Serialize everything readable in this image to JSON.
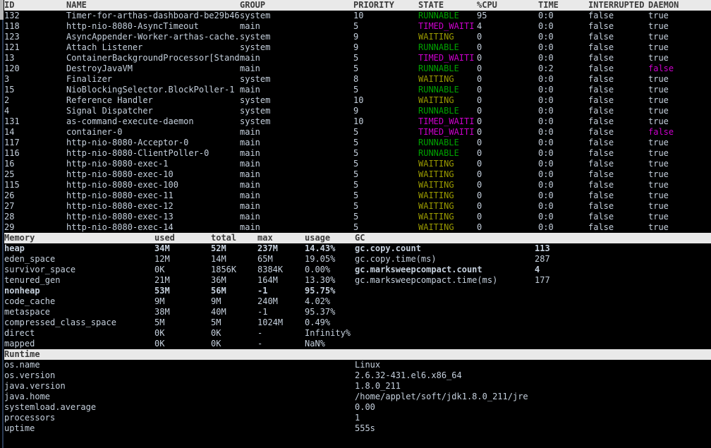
{
  "app": {
    "name": "arthas-dashboard",
    "terminal_bg": "#000000",
    "fg": "#c5d0dd",
    "header_bg": "#e9e9e9",
    "header_fg": "#3a3a3a",
    "state_colors": {
      "RUNNABLE": "#00a000",
      "TIMED_WAITI": "#cc00cc",
      "WAITING": "#9a9a00"
    }
  },
  "threads": {
    "columns": [
      "ID",
      "NAME",
      "GROUP",
      "PRIORITY",
      "STATE",
      "%CPU",
      "TIME",
      "INTERRUPTED",
      "DAEMON"
    ],
    "rows": [
      {
        "id": "132",
        "name": "Timer-for-arthas-dashboard-be29b46",
        "group": "system",
        "priority": "10",
        "state": "RUNNABLE",
        "state_color": "green",
        "cpu": "95",
        "time": "0:0",
        "interrupted": "false",
        "daemon": "true",
        "daemon_color": "default"
      },
      {
        "id": "118",
        "name": "http-nio-8080-AsyncTimeout",
        "group": "main",
        "priority": "5",
        "state": "TIMED_WAITI",
        "state_color": "magenta",
        "cpu": "4",
        "time": "0:0",
        "interrupted": "false",
        "daemon": "true",
        "daemon_color": "default"
      },
      {
        "id": "123",
        "name": "AsyncAppender-Worker-arthas-cache.",
        "group": "system",
        "priority": "9",
        "state": "WAITING",
        "state_color": "yellow",
        "cpu": "0",
        "time": "0:0",
        "interrupted": "false",
        "daemon": "true",
        "daemon_color": "default"
      },
      {
        "id": "121",
        "name": "Attach Listener",
        "group": "system",
        "priority": "9",
        "state": "RUNNABLE",
        "state_color": "green",
        "cpu": "0",
        "time": "0:0",
        "interrupted": "false",
        "daemon": "true",
        "daemon_color": "default"
      },
      {
        "id": "13",
        "name": "ContainerBackgroundProcessor[Stand",
        "group": "main",
        "priority": "5",
        "state": "TIMED_WAITI",
        "state_color": "magenta",
        "cpu": "0",
        "time": "0:0",
        "interrupted": "false",
        "daemon": "true",
        "daemon_color": "default"
      },
      {
        "id": "120",
        "name": "DestroyJavaVM",
        "group": "main",
        "priority": "5",
        "state": "RUNNABLE",
        "state_color": "green",
        "cpu": "0",
        "time": "0:2",
        "interrupted": "false",
        "daemon": "false",
        "daemon_color": "magenta"
      },
      {
        "id": "3",
        "name": "Finalizer",
        "group": "system",
        "priority": "8",
        "state": "WAITING",
        "state_color": "yellow",
        "cpu": "0",
        "time": "0:0",
        "interrupted": "false",
        "daemon": "true",
        "daemon_color": "default"
      },
      {
        "id": "15",
        "name": "NioBlockingSelector.BlockPoller-1",
        "group": "main",
        "priority": "5",
        "state": "RUNNABLE",
        "state_color": "green",
        "cpu": "0",
        "time": "0:0",
        "interrupted": "false",
        "daemon": "true",
        "daemon_color": "default"
      },
      {
        "id": "2",
        "name": "Reference Handler",
        "group": "system",
        "priority": "10",
        "state": "WAITING",
        "state_color": "yellow",
        "cpu": "0",
        "time": "0:0",
        "interrupted": "false",
        "daemon": "true",
        "daemon_color": "default"
      },
      {
        "id": "4",
        "name": "Signal Dispatcher",
        "group": "system",
        "priority": "9",
        "state": "RUNNABLE",
        "state_color": "green",
        "cpu": "0",
        "time": "0:0",
        "interrupted": "false",
        "daemon": "true",
        "daemon_color": "default"
      },
      {
        "id": "131",
        "name": "as-command-execute-daemon",
        "group": "system",
        "priority": "10",
        "state": "TIMED_WAITI",
        "state_color": "magenta",
        "cpu": "0",
        "time": "0:0",
        "interrupted": "false",
        "daemon": "true",
        "daemon_color": "default"
      },
      {
        "id": "14",
        "name": "container-0",
        "group": "main",
        "priority": "5",
        "state": "TIMED_WAITI",
        "state_color": "magenta",
        "cpu": "0",
        "time": "0:0",
        "interrupted": "false",
        "daemon": "false",
        "daemon_color": "magenta"
      },
      {
        "id": "117",
        "name": "http-nio-8080-Acceptor-0",
        "group": "main",
        "priority": "5",
        "state": "RUNNABLE",
        "state_color": "green",
        "cpu": "0",
        "time": "0:0",
        "interrupted": "false",
        "daemon": "true",
        "daemon_color": "default"
      },
      {
        "id": "116",
        "name": "http-nio-8080-ClientPoller-0",
        "group": "main",
        "priority": "5",
        "state": "RUNNABLE",
        "state_color": "green",
        "cpu": "0",
        "time": "0:0",
        "interrupted": "false",
        "daemon": "true",
        "daemon_color": "default"
      },
      {
        "id": "16",
        "name": "http-nio-8080-exec-1",
        "group": "main",
        "priority": "5",
        "state": "WAITING",
        "state_color": "yellow",
        "cpu": "0",
        "time": "0:0",
        "interrupted": "false",
        "daemon": "true",
        "daemon_color": "default"
      },
      {
        "id": "25",
        "name": "http-nio-8080-exec-10",
        "group": "main",
        "priority": "5",
        "state": "WAITING",
        "state_color": "yellow",
        "cpu": "0",
        "time": "0:0",
        "interrupted": "false",
        "daemon": "true",
        "daemon_color": "default"
      },
      {
        "id": "115",
        "name": "http-nio-8080-exec-100",
        "group": "main",
        "priority": "5",
        "state": "WAITING",
        "state_color": "yellow",
        "cpu": "0",
        "time": "0:0",
        "interrupted": "false",
        "daemon": "true",
        "daemon_color": "default"
      },
      {
        "id": "26",
        "name": "http-nio-8080-exec-11",
        "group": "main",
        "priority": "5",
        "state": "WAITING",
        "state_color": "yellow",
        "cpu": "0",
        "time": "0:0",
        "interrupted": "false",
        "daemon": "true",
        "daemon_color": "default"
      },
      {
        "id": "27",
        "name": "http-nio-8080-exec-12",
        "group": "main",
        "priority": "5",
        "state": "WAITING",
        "state_color": "yellow",
        "cpu": "0",
        "time": "0:0",
        "interrupted": "false",
        "daemon": "true",
        "daemon_color": "default"
      },
      {
        "id": "28",
        "name": "http-nio-8080-exec-13",
        "group": "main",
        "priority": "5",
        "state": "WAITING",
        "state_color": "yellow",
        "cpu": "0",
        "time": "0:0",
        "interrupted": "false",
        "daemon": "true",
        "daemon_color": "default"
      },
      {
        "id": "29",
        "name": "http-nio-8080-exec-14",
        "group": "main",
        "priority": "5",
        "state": "WAITING",
        "state_color": "yellow",
        "cpu": "0",
        "time": "0:0",
        "interrupted": "false",
        "daemon": "true",
        "daemon_color": "default"
      }
    ]
  },
  "memory": {
    "columns": [
      "Memory",
      "used",
      "total",
      "max",
      "usage"
    ],
    "rows": [
      {
        "name": "heap",
        "used": "34M",
        "total": "52M",
        "max": "237M",
        "usage": "14.43%",
        "bold": true
      },
      {
        "name": "eden_space",
        "used": "12M",
        "total": "14M",
        "max": "65M",
        "usage": "19.05%",
        "bold": false
      },
      {
        "name": "survivor_space",
        "used": "0K",
        "total": "1856K",
        "max": "8384K",
        "usage": "0.00%",
        "bold": false
      },
      {
        "name": "tenured_gen",
        "used": "21M",
        "total": "36M",
        "max": "164M",
        "usage": "13.30%",
        "bold": false
      },
      {
        "name": "nonheap",
        "used": "53M",
        "total": "56M",
        "max": "-1",
        "usage": "95.75%",
        "bold": true
      },
      {
        "name": "code_cache",
        "used": "9M",
        "total": "9M",
        "max": "240M",
        "usage": "4.02%",
        "bold": false
      },
      {
        "name": "metaspace",
        "used": "38M",
        "total": "40M",
        "max": "-1",
        "usage": "95.37%",
        "bold": false
      },
      {
        "name": "compressed_class_space",
        "used": "5M",
        "total": "5M",
        "max": "1024M",
        "usage": "0.49%",
        "bold": false
      },
      {
        "name": "direct",
        "used": "0K",
        "total": "0K",
        "max": "-",
        "usage": "Infinity%",
        "bold": false
      },
      {
        "name": "mapped",
        "used": "0K",
        "total": "0K",
        "max": "-",
        "usage": "NaN%",
        "bold": false
      }
    ]
  },
  "gc": {
    "header": "GC",
    "rows": [
      {
        "name": "gc.copy.count",
        "value": "113",
        "bold": true
      },
      {
        "name": "gc.copy.time(ms)",
        "value": "287",
        "bold": false
      },
      {
        "name": "gc.marksweepcompact.count",
        "value": "4",
        "bold": true
      },
      {
        "name": "gc.marksweepcompact.time(ms)",
        "value": "177",
        "bold": false
      }
    ]
  },
  "runtime": {
    "header": "Runtime",
    "rows": [
      {
        "name": "os.name",
        "value": "Linux"
      },
      {
        "name": "os.version",
        "value": "2.6.32-431.el6.x86_64"
      },
      {
        "name": "java.version",
        "value": "1.8.0_211"
      },
      {
        "name": "java.home",
        "value": "/home/applet/soft/jdk1.8.0_211/jre"
      },
      {
        "name": "systemload.average",
        "value": "0.00"
      },
      {
        "name": "processors",
        "value": "1"
      },
      {
        "name": "uptime",
        "value": "555s"
      }
    ]
  }
}
